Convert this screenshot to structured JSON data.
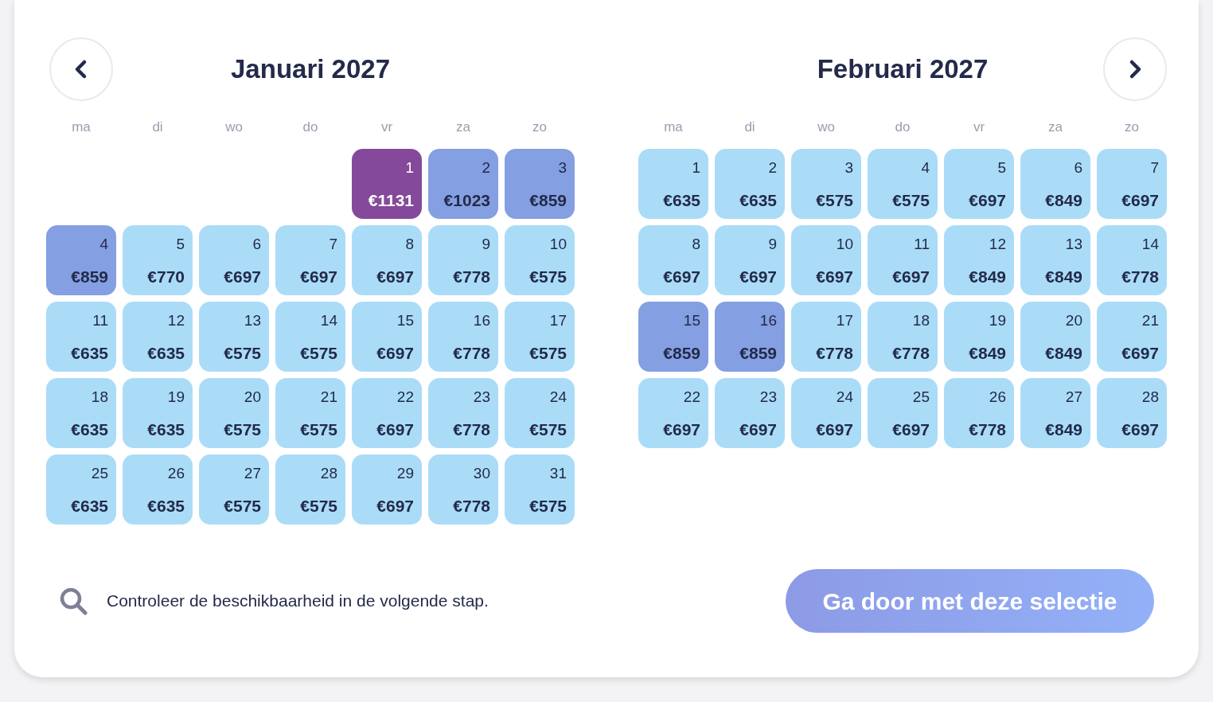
{
  "months": [
    {
      "title": "Januari 2027",
      "kind": "left",
      "weekdays": [
        "ma",
        "di",
        "wo",
        "do",
        "vr",
        "za",
        "zo"
      ],
      "days": [
        {
          "kind": "blank"
        },
        {
          "kind": "blank"
        },
        {
          "kind": "blank"
        },
        {
          "kind": "blank"
        },
        {
          "day": "1",
          "price": "€1131",
          "color": "#84499a"
        },
        {
          "day": "2",
          "price": "€1023",
          "color": "#849fe2"
        },
        {
          "day": "3",
          "price": "€859",
          "color": "#849fe2"
        },
        {
          "day": "4",
          "price": "€859",
          "color": "#849fe2"
        },
        {
          "day": "5",
          "price": "€770",
          "color": "#aadcf8"
        },
        {
          "day": "6",
          "price": "€697",
          "color": "#aadcf8"
        },
        {
          "day": "7",
          "price": "€697",
          "color": "#aadcf8"
        },
        {
          "day": "8",
          "price": "€697",
          "color": "#aadcf8"
        },
        {
          "day": "9",
          "price": "€778",
          "color": "#aadcf8"
        },
        {
          "day": "10",
          "price": "€575",
          "color": "#aadcf8"
        },
        {
          "day": "11",
          "price": "€635",
          "color": "#aadcf8"
        },
        {
          "day": "12",
          "price": "€635",
          "color": "#aadcf8"
        },
        {
          "day": "13",
          "price": "€575",
          "color": "#aadcf8"
        },
        {
          "day": "14",
          "price": "€575",
          "color": "#aadcf8"
        },
        {
          "day": "15",
          "price": "€697",
          "color": "#aadcf8"
        },
        {
          "day": "16",
          "price": "€778",
          "color": "#aadcf8"
        },
        {
          "day": "17",
          "price": "€575",
          "color": "#aadcf8"
        },
        {
          "day": "18",
          "price": "€635",
          "color": "#aadcf8"
        },
        {
          "day": "19",
          "price": "€635",
          "color": "#aadcf8"
        },
        {
          "day": "20",
          "price": "€575",
          "color": "#aadcf8"
        },
        {
          "day": "21",
          "price": "€575",
          "color": "#aadcf8"
        },
        {
          "day": "22",
          "price": "€697",
          "color": "#aadcf8"
        },
        {
          "day": "23",
          "price": "€778",
          "color": "#aadcf8"
        },
        {
          "day": "24",
          "price": "€575",
          "color": "#aadcf8"
        },
        {
          "day": "25",
          "price": "€635",
          "color": "#aadcf8"
        },
        {
          "day": "26",
          "price": "€635",
          "color": "#aadcf8"
        },
        {
          "day": "27",
          "price": "€575",
          "color": "#aadcf8"
        },
        {
          "day": "28",
          "price": "€575",
          "color": "#aadcf8"
        },
        {
          "day": "29",
          "price": "€697",
          "color": "#aadcf8"
        },
        {
          "day": "30",
          "price": "€778",
          "color": "#aadcf8"
        },
        {
          "day": "31",
          "price": "€575",
          "color": "#aadcf8"
        }
      ]
    },
    {
      "title": "Februari 2027",
      "kind": "right",
      "weekdays": [
        "ma",
        "di",
        "wo",
        "do",
        "vr",
        "za",
        "zo"
      ],
      "days": [
        {
          "day": "1",
          "price": "€635",
          "color": "#aadcf8"
        },
        {
          "day": "2",
          "price": "€635",
          "color": "#aadcf8"
        },
        {
          "day": "3",
          "price": "€575",
          "color": "#aadcf8"
        },
        {
          "day": "4",
          "price": "€575",
          "color": "#aadcf8"
        },
        {
          "day": "5",
          "price": "€697",
          "color": "#aadcf8"
        },
        {
          "day": "6",
          "price": "€849",
          "color": "#aadcf8"
        },
        {
          "day": "7",
          "price": "€697",
          "color": "#aadcf8"
        },
        {
          "day": "8",
          "price": "€697",
          "color": "#aadcf8"
        },
        {
          "day": "9",
          "price": "€697",
          "color": "#aadcf8"
        },
        {
          "day": "10",
          "price": "€697",
          "color": "#aadcf8"
        },
        {
          "day": "11",
          "price": "€697",
          "color": "#aadcf8"
        },
        {
          "day": "12",
          "price": "€849",
          "color": "#aadcf8"
        },
        {
          "day": "13",
          "price": "€849",
          "color": "#aadcf8"
        },
        {
          "day": "14",
          "price": "€778",
          "color": "#aadcf8"
        },
        {
          "day": "15",
          "price": "€859",
          "color": "#849fe2"
        },
        {
          "day": "16",
          "price": "€859",
          "color": "#849fe2"
        },
        {
          "day": "17",
          "price": "€778",
          "color": "#aadcf8"
        },
        {
          "day": "18",
          "price": "€778",
          "color": "#aadcf8"
        },
        {
          "day": "19",
          "price": "€849",
          "color": "#aadcf8"
        },
        {
          "day": "20",
          "price": "€849",
          "color": "#aadcf8"
        },
        {
          "day": "21",
          "price": "€697",
          "color": "#aadcf8"
        },
        {
          "day": "22",
          "price": "€697",
          "color": "#aadcf8"
        },
        {
          "day": "23",
          "price": "€697",
          "color": "#aadcf8"
        },
        {
          "day": "24",
          "price": "€697",
          "color": "#aadcf8"
        },
        {
          "day": "25",
          "price": "€697",
          "color": "#aadcf8"
        },
        {
          "day": "26",
          "price": "€778",
          "color": "#aadcf8"
        },
        {
          "day": "27",
          "price": "€849",
          "color": "#aadcf8"
        },
        {
          "day": "28",
          "price": "€697",
          "color": "#aadcf8"
        }
      ]
    }
  ],
  "footer": {
    "note": "Controleer de beschikbaarheid in de volgende stap.",
    "button": "Ga door met deze selectie"
  }
}
